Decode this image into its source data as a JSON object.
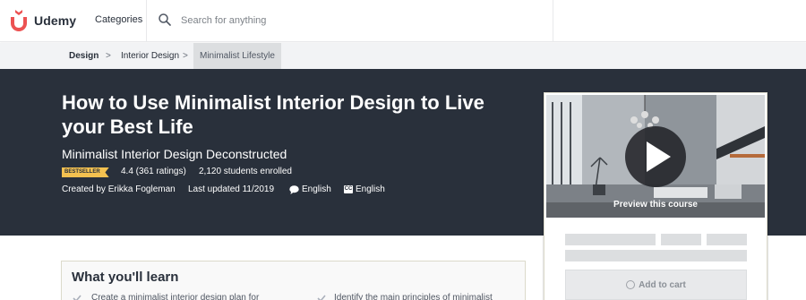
{
  "header": {
    "logo_text": "Udemy",
    "categories_label": "Categories",
    "search_placeholder": "Search for anything"
  },
  "breadcrumb": {
    "items": [
      "Design",
      "Interior Design",
      "Minimalist Lifestyle"
    ],
    "separator": ">"
  },
  "course": {
    "title": "How to Use Minimalist Interior Design to Live your Best Life",
    "subtitle": "Minimalist Interior Design Deconstructed",
    "badge": "BESTSELLER",
    "rating_text": "4.4 (361 ratings)",
    "students_text": "2,120 students enrolled",
    "created_by": "Created by Erikka Fogleman",
    "last_updated": "Last updated 11/2019",
    "language": "English",
    "captions": "English",
    "cc_icon_text": "CC"
  },
  "sidebar": {
    "preview_label": "Preview this course",
    "add_to_cart_label": "Add to cart"
  },
  "learn": {
    "title": "What you'll learn",
    "items": [
      "Create a minimalist interior design plan for",
      "Identify the main principles of minimalist"
    ]
  },
  "colors": {
    "brand": "#ec5252",
    "hero_bg": "#29303b",
    "badge": "#f4c150",
    "check": "#aab0bb"
  }
}
